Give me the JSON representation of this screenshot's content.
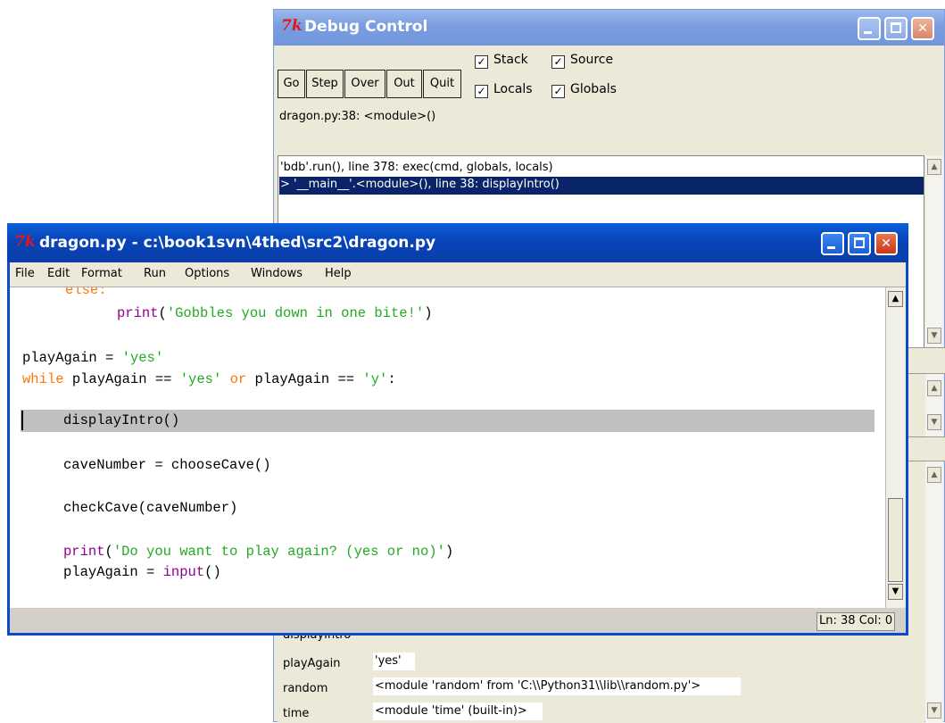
{
  "debug_window": {
    "title": "Debug Control",
    "tk_logo": "7k",
    "buttons": {
      "go": "Go",
      "step": "Step",
      "over": "Over",
      "out": "Out",
      "quit": "Quit"
    },
    "checkboxes": {
      "stack": "Stack",
      "source": "Source",
      "locals": "Locals",
      "globals": "Globals"
    },
    "location": "dragon.py:38: <module>()",
    "stack": [
      "'bdb'.run(), line 378: exec(cmd, globals, locals)",
      "> '__main__'.<module>(), line 38: displayIntro()"
    ],
    "globals_partial": "displayIntro",
    "globals": [
      {
        "name": "playAgain",
        "value": "'yes'"
      },
      {
        "name": "random",
        "value": "<module 'random' from 'C:\\\\Python31\\\\lib\\\\random.py'>"
      },
      {
        "name": "time",
        "value": "<module 'time' (built-in)>"
      }
    ]
  },
  "editor_window": {
    "title": "dragon.py - c:\\book1svn\\4thed\\src2\\dragon.py",
    "tk_logo": "7k",
    "menu": [
      "File",
      "Edit",
      "Format",
      "Run",
      "Options",
      "Windows",
      "Help"
    ],
    "code": {
      "else_kw": "else:",
      "print1_fn": "print",
      "print1_str": "'Gobbles you down in one bite!'",
      "playagain_assign": "playAgain = ",
      "playagain_val": "'yes'",
      "while_kw": "while",
      "while_mid1": " playAgain == ",
      "while_yes": "'yes'",
      "or_kw": "or",
      "while_mid2": " playAgain == ",
      "while_y": "'y'",
      "while_colon": ":",
      "display_intro": "displayIntro()",
      "cave_number": "caveNumber = chooseCave()",
      "check_cave": "checkCave(caveNumber)",
      "print2_fn": "print",
      "print2_str": "'Do you want to play again? (yes or no)'",
      "input_assign": "playAgain = ",
      "input_fn": "input",
      "input_parens": "()"
    },
    "status": {
      "ln": "Ln: 38",
      "col": "Col: 0"
    }
  },
  "colors": {
    "keyword": "#ff7700",
    "string": "#22aa22",
    "builtin": "#900090",
    "highlight": "#c0c0c0",
    "selection": "#0a246a"
  }
}
